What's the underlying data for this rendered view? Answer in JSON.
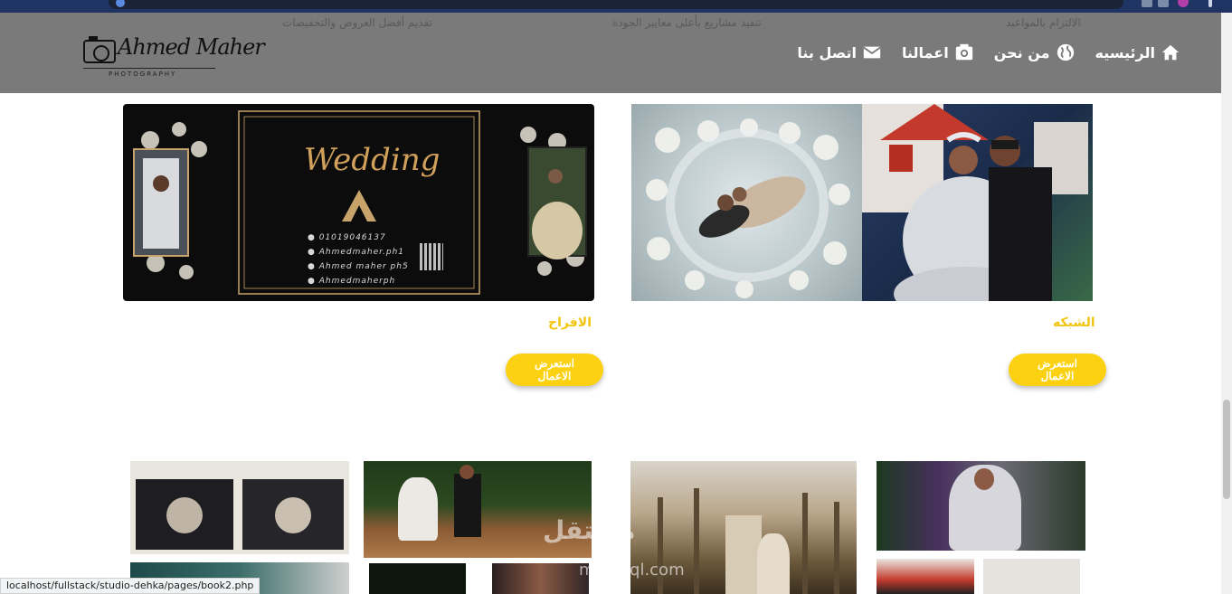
{
  "browser": {
    "status_url": "localhost/fullstack/studio-dehka/pages/book2.php"
  },
  "header": {
    "faded_texts": [
      "الالتزام بالمواعيد",
      "تنفيذ مشاريع بأعلى معايير الجودة",
      "تقديم أفضل العروض والتخفيضات"
    ],
    "logo": {
      "name": "Ahmed Maher",
      "sub": "PHOTOGRAPHY"
    },
    "nav": [
      {
        "label": "الرئيسيه",
        "icon": "home-icon"
      },
      {
        "label": "من نحن",
        "icon": "globe-icon"
      },
      {
        "label": "اعمالنا",
        "icon": "camera-icon"
      },
      {
        "label": "اتصل بنا",
        "icon": "envelope-icon"
      }
    ]
  },
  "cards": [
    {
      "title": "الشبكه",
      "button": "استعرض الاعمال"
    },
    {
      "title": "الافراح",
      "button": "استعرض الاعمال"
    }
  ],
  "wedding_card": {
    "heading": "Wedding",
    "phone": "01019046137",
    "facebook": "Ahmedmaher.ph1",
    "instagram": "Ahmed maher ph5",
    "other": "Ahmedmaherph"
  },
  "watermark": {
    "arabic": "مستقل",
    "latin": "mostaql.com"
  },
  "colors": {
    "accent": "#fcd111",
    "title": "#f3c40d",
    "header": "#7a7a7a"
  }
}
